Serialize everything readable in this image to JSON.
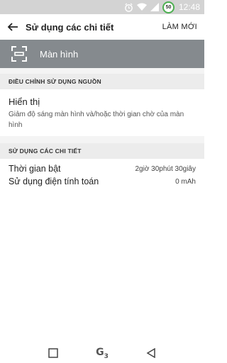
{
  "status_bar": {
    "icons": [
      "alarm-icon",
      "wifi-icon",
      "signal-icon"
    ],
    "battery": "50",
    "time": "12:48"
  },
  "app_bar": {
    "title": "Sử dụng các chi tiết",
    "refresh_label": "LÀM MỚI"
  },
  "banner": {
    "icon": "screen-icon",
    "label": "Màn hình"
  },
  "adjust_section": {
    "header": "ĐIỀU CHỈNH SỬ DỤNG NGUỒN",
    "item": {
      "title": "Hiển thị",
      "description": "Giảm độ sáng màn hình và/hoặc thời gian chờ của màn hình"
    }
  },
  "details_section": {
    "header": "SỬ DỤNG CÁC CHI TIẾT",
    "rows": [
      {
        "label": "Thời gian bật",
        "value": "2giờ 30phút 30giây"
      },
      {
        "label": "Sử dụng điện tính toán",
        "value": "0 mAh"
      }
    ]
  },
  "nav_bar": {
    "logo": "G",
    "logo_sub": "3"
  },
  "colors": {
    "status_bar": "#d3d3d3",
    "banner": "#858a8e",
    "battery_ring": "#4caf50"
  }
}
